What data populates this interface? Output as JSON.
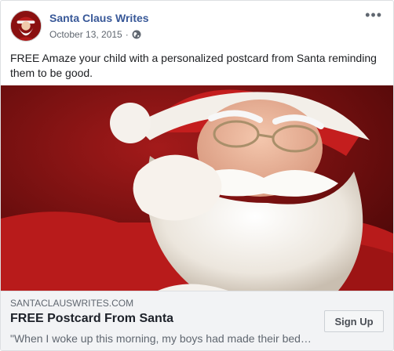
{
  "post": {
    "page_name": "Santa Claus Writes",
    "date": "October 13, 2015",
    "separator": "·",
    "privacy_icon": "globe-icon",
    "more_icon": "more-options-icon",
    "more_glyph": "•••",
    "text": "FREE Amaze your child with a personalized postcard from Santa reminding them to be good."
  },
  "link_preview": {
    "domain": "SANTACLAUSWRITES.COM",
    "title": "FREE Postcard From Santa",
    "description": "\"When I woke up this morning, my boys had made their bed…",
    "cta_label": "Sign Up"
  },
  "colors": {
    "page_name": "#385898",
    "background_red": "#8e1414",
    "link_box_bg": "#f2f3f5"
  }
}
